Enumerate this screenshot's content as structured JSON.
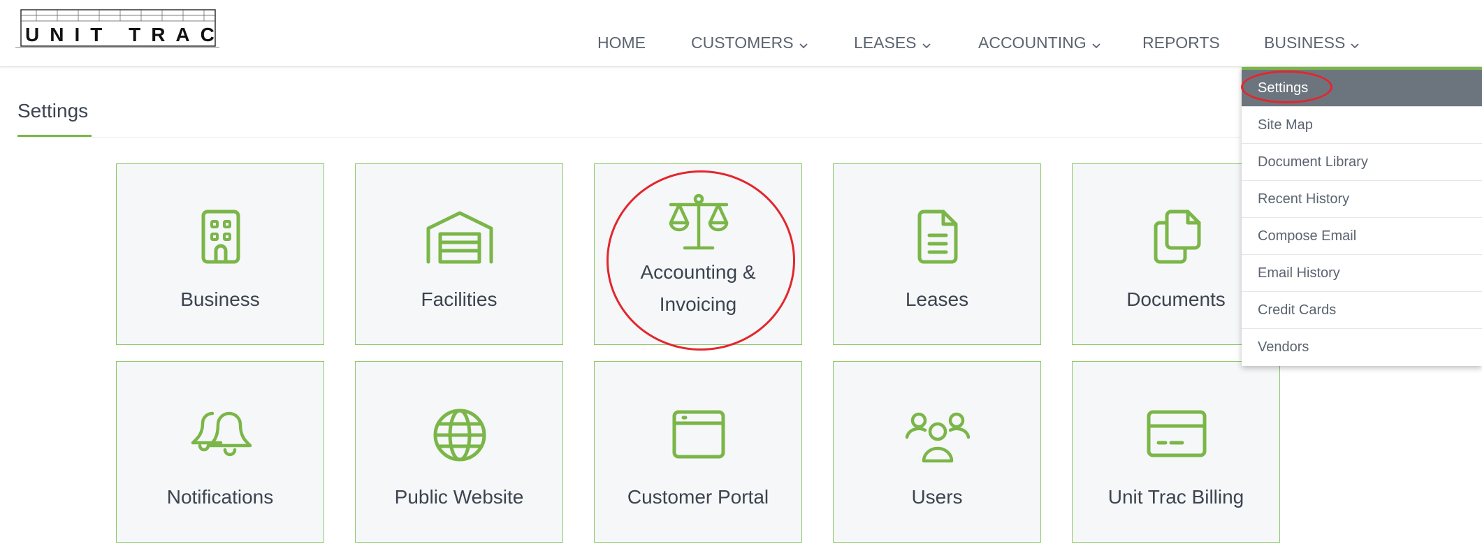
{
  "brand": {
    "logo_text": "UNIT TRAC",
    "accent_color": "#7ab648",
    "highlight_color": "#e3262d"
  },
  "nav": {
    "items": [
      {
        "label": "HOME",
        "has_dropdown": false
      },
      {
        "label": "CUSTOMERS",
        "has_dropdown": true
      },
      {
        "label": "LEASES",
        "has_dropdown": true
      },
      {
        "label": "ACCOUNTING",
        "has_dropdown": true
      },
      {
        "label": "REPORTS",
        "has_dropdown": false
      },
      {
        "label": "BUSINESS",
        "has_dropdown": true
      }
    ]
  },
  "page": {
    "title": "Settings"
  },
  "tiles": [
    {
      "label": "Business",
      "icon": "building-icon"
    },
    {
      "label": "Facilities",
      "icon": "garage-icon"
    },
    {
      "label": "Accounting & Invoicing",
      "line1": "Accounting &",
      "line2": "Invoicing",
      "icon": "scale-icon"
    },
    {
      "label": "Leases",
      "icon": "document-icon"
    },
    {
      "label": "Documents",
      "icon": "copy-icon"
    },
    {
      "label": "Notifications",
      "icon": "bells-icon"
    },
    {
      "label": "Public Website",
      "icon": "globe-icon"
    },
    {
      "label": "Customer Portal",
      "icon": "browser-window-icon"
    },
    {
      "label": "Users",
      "icon": "users-icon"
    },
    {
      "label": "Unit Trac Billing",
      "icon": "credit-card-icon"
    }
  ],
  "business_menu": {
    "items": [
      {
        "label": "Settings",
        "active": true
      },
      {
        "label": "Site Map"
      },
      {
        "label": "Document Library"
      },
      {
        "label": "Recent History"
      },
      {
        "label": "Compose Email"
      },
      {
        "label": "Email History"
      },
      {
        "label": "Credit Cards"
      },
      {
        "label": "Vendors"
      }
    ]
  }
}
